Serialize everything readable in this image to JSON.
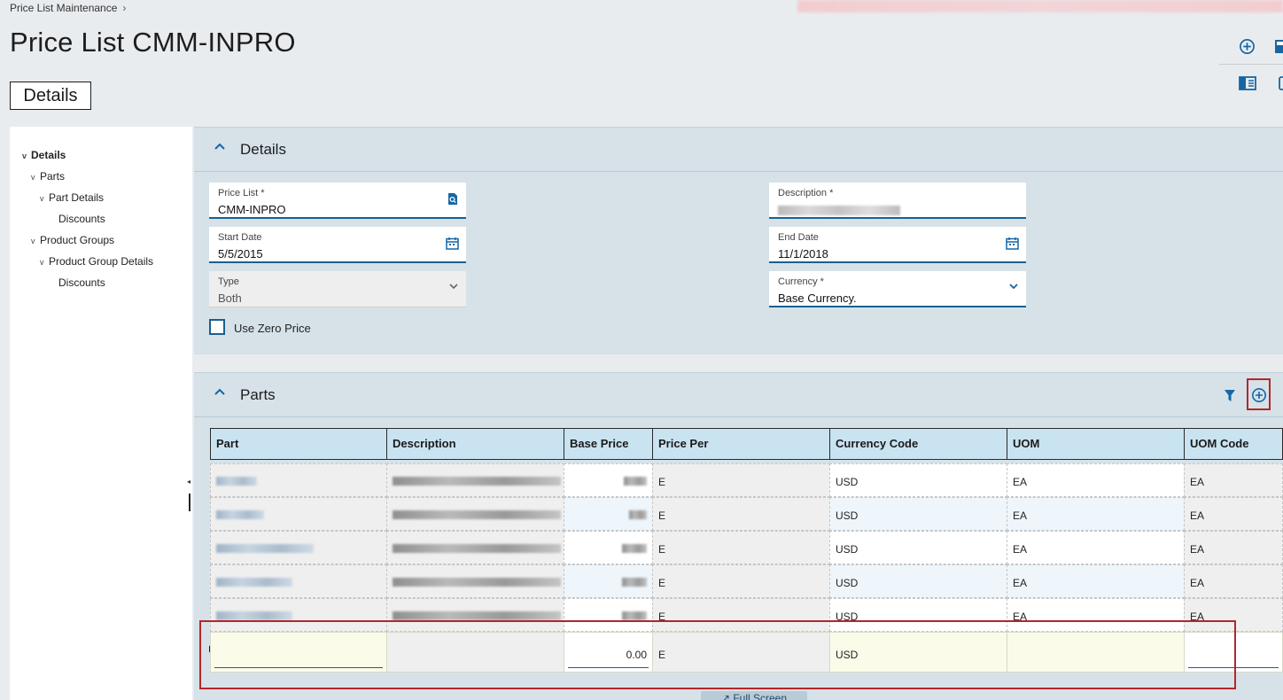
{
  "breadcrumb": {
    "item": "Price List Maintenance",
    "chevron": "›"
  },
  "page": {
    "title": "Price List CMM-INPRO",
    "tab": "Details"
  },
  "toolbar": {
    "icons": [
      "add-circle-icon",
      "save-icon",
      "panel-layout-icon",
      "copy-icon"
    ]
  },
  "tree": {
    "items": [
      {
        "label": "Details",
        "caret": "v"
      },
      {
        "label": "Parts",
        "caret": "v"
      },
      {
        "label": "Part Details",
        "caret": "v"
      },
      {
        "label": "Discounts",
        "caret": ""
      },
      {
        "label": "Product Groups",
        "caret": "v"
      },
      {
        "label": "Product Group Details",
        "caret": "v"
      },
      {
        "label": "Discounts",
        "caret": ""
      }
    ]
  },
  "details": {
    "title": "Details",
    "price_list": {
      "label": "Price List *",
      "value": "CMM-INPRO"
    },
    "description": {
      "label": "Description *",
      "value": ""
    },
    "start_date": {
      "label": "Start Date",
      "value": "5/5/2015"
    },
    "end_date": {
      "label": "End Date",
      "value": "11/1/2018"
    },
    "type": {
      "label": "Type",
      "value": "Both"
    },
    "currency": {
      "label": "Currency *",
      "value": "Base Currency."
    },
    "use_zero_price": {
      "label": "Use Zero Price",
      "checked": false
    }
  },
  "parts": {
    "title": "Parts",
    "columns": [
      "Part",
      "Description",
      "Base Price",
      "Price Per",
      "Currency Code",
      "UOM",
      "UOM Code"
    ],
    "rows": [
      {
        "price_per": "E",
        "currency": "USD",
        "uom": "EA",
        "uom_code": "EA"
      },
      {
        "price_per": "E",
        "currency": "USD",
        "uom": "EA",
        "uom_code": "EA"
      },
      {
        "price_per": "E",
        "currency": "USD",
        "uom": "EA",
        "uom_code": "EA"
      },
      {
        "price_per": "E",
        "currency": "USD",
        "uom": "EA",
        "uom_code": "EA"
      },
      {
        "price_per": "E",
        "currency": "USD",
        "uom": "EA",
        "uom_code": "EA"
      }
    ],
    "new_row": {
      "part": "",
      "description": "",
      "base_price": "0.00",
      "price_per": "E",
      "currency": "USD",
      "uom": "",
      "uom_code": ""
    }
  },
  "fullscreen": {
    "label": "↗ Full Screen"
  }
}
